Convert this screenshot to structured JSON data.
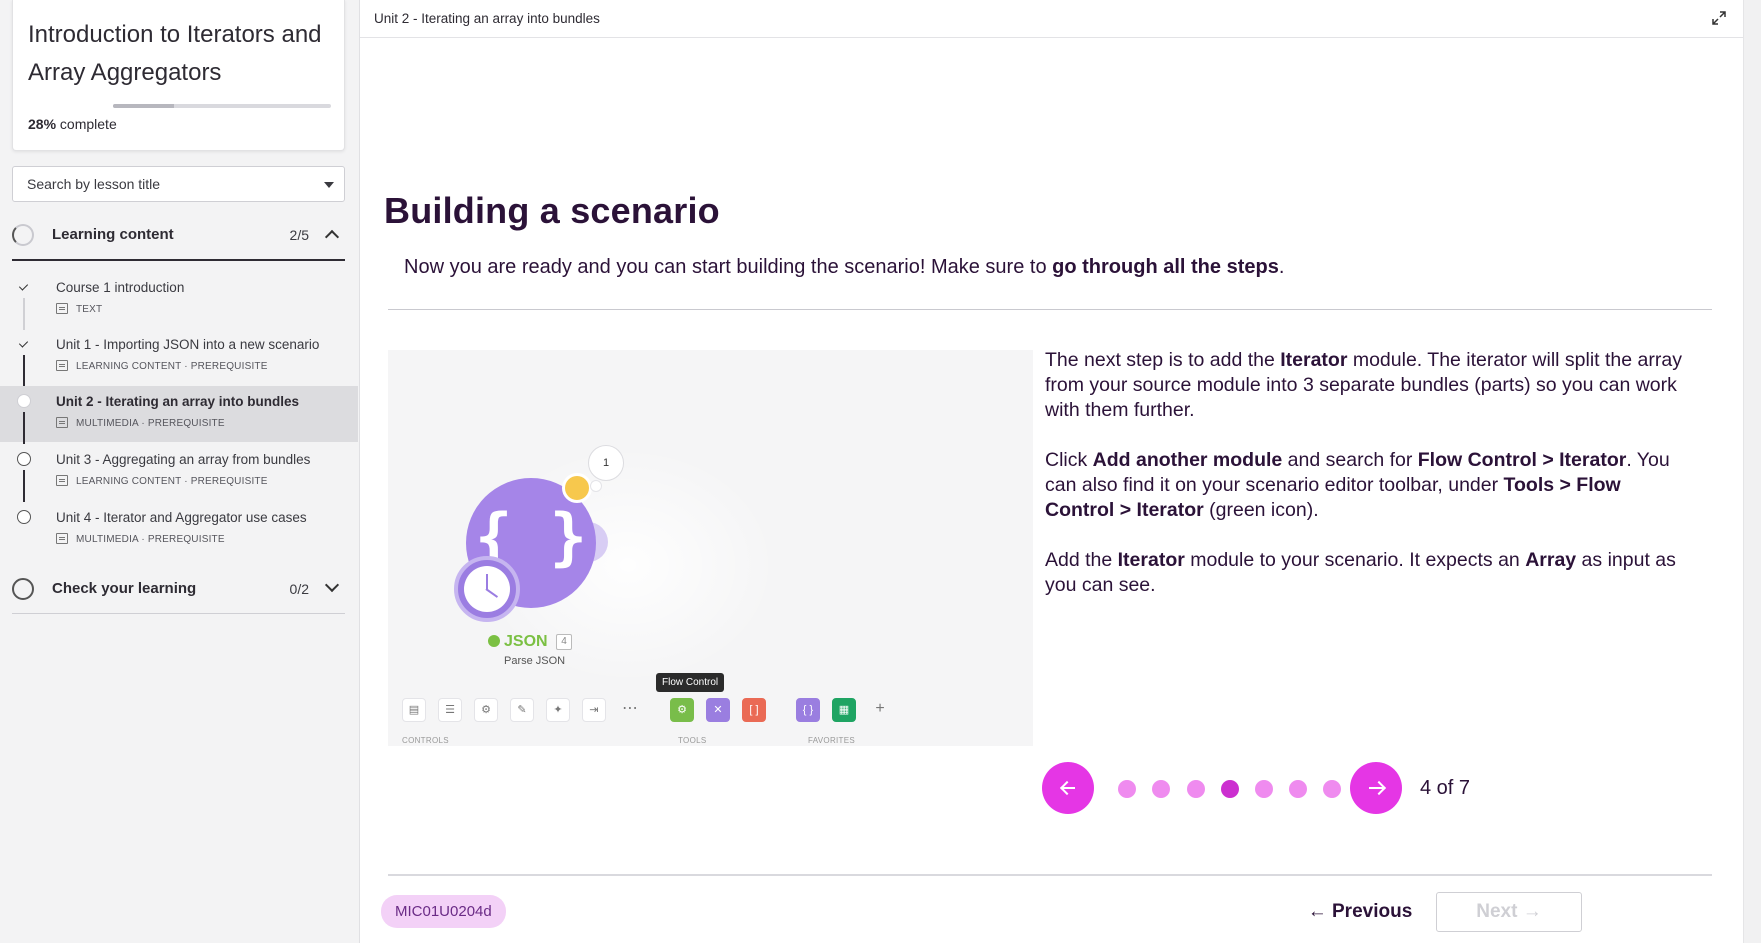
{
  "course": {
    "title": "Introduction to Iterators and Array Aggregators",
    "progress_percent_label": "28%",
    "progress_suffix": "complete",
    "progress_fraction": 0.28
  },
  "search": {
    "placeholder": "Search by lesson title"
  },
  "sections": [
    {
      "label": "Learning content",
      "count": "2/5",
      "expanded": true
    },
    {
      "label": "Check your learning",
      "count": "0/2",
      "expanded": false
    }
  ],
  "lessons": [
    {
      "title": "Course 1 introduction",
      "meta": "TEXT",
      "status": "done"
    },
    {
      "title": "Unit 1 - Importing JSON into a new scenario",
      "meta": "LEARNING CONTENT · PREREQUISITE",
      "status": "done"
    },
    {
      "title": "Unit 2 - Iterating an array into bundles",
      "meta": "MULTIMEDIA · PREREQUISITE",
      "status": "current"
    },
    {
      "title": "Unit 3 - Aggregating an array from bundles",
      "meta": "LEARNING CONTENT · PREREQUISITE",
      "status": "open"
    },
    {
      "title": "Unit 4 - Iterator and Aggregator use cases",
      "meta": "MULTIMEDIA · PREREQUISITE",
      "status": "open"
    }
  ],
  "topbar": {
    "breadcrumb": "Unit 2 - Iterating an array into bundles"
  },
  "lesson": {
    "heading": "Building a scenario",
    "intro_pre": "Now you are ready and you can start building the scenario! Make sure to ",
    "intro_bold": "go through all the steps",
    "intro_post": ".",
    "paragraphs": [
      [
        {
          "t": "The next step is to add the "
        },
        {
          "t": "Iterator",
          "b": true
        },
        {
          "t": " module. The iterator will split the array from your source module into 3 separate bundles (parts) so you can work with them further."
        }
      ],
      [
        {
          "t": "Click "
        },
        {
          "t": "Add another module",
          "b": true
        },
        {
          "t": " and search for "
        },
        {
          "t": "Flow Control > Iterator",
          "b": true
        },
        {
          "t": ". You can also find it on your scenario editor toolbar, under "
        },
        {
          "t": "Tools > Flow Control > Iterator",
          "b": true
        },
        {
          "t": " (green icon)."
        }
      ],
      [
        {
          "t": "Add the "
        },
        {
          "t": "Iterator",
          "b": true
        },
        {
          "t": " module to your scenario. It expects an "
        },
        {
          "t": "Array",
          "b": true
        },
        {
          "t": " as input as you can see."
        }
      ]
    ]
  },
  "illustration": {
    "bubble_number": "1",
    "module_name": "JSON",
    "module_count": "4",
    "module_subtitle": "Parse JSON",
    "tooltip": "Flow Control",
    "toolbar_labels": [
      "CONTROLS",
      "TOOLS",
      "FAVORITES"
    ]
  },
  "pager": {
    "current": 4,
    "total": 7,
    "label": "4 of 7"
  },
  "footer": {
    "code": "MIC01U0204d",
    "previous_label": "Previous",
    "next_label": "Next",
    "previous_arrow": "←",
    "next_arrow": "→"
  },
  "colors": {
    "accent": "#e536e5",
    "dot": "#ef8bef",
    "dot_current": "#cc2fd0",
    "text": "#2b1238"
  }
}
